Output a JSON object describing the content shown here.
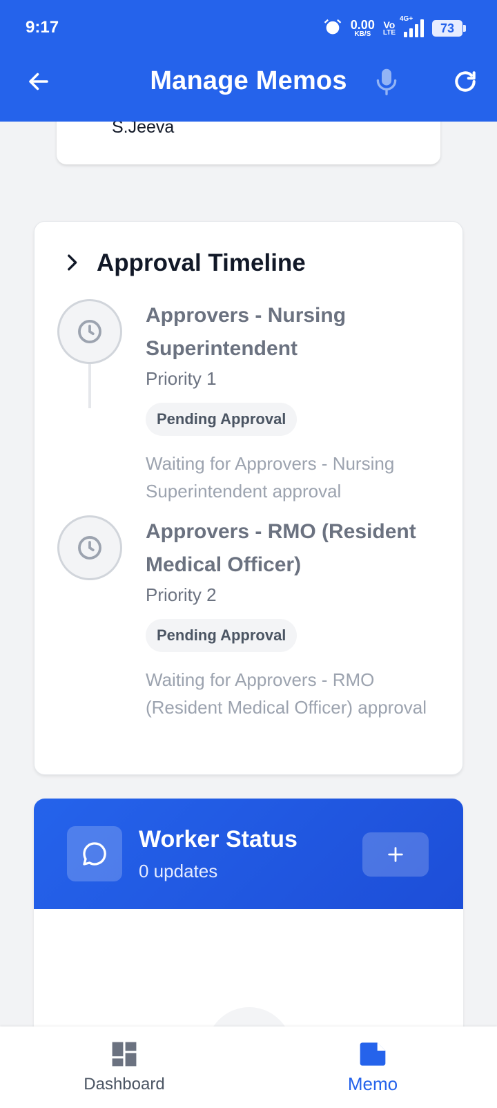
{
  "status_bar": {
    "time": "9:17",
    "net_speed_value": "0.00",
    "net_speed_unit": "KB/S",
    "volte_top": "Vo",
    "volte_bottom": "LTE",
    "network_type": "4G+",
    "battery_level": "73"
  },
  "header": {
    "title": "Manage Memos",
    "back_icon": "arrow-left-icon",
    "mic_icon": "microphone-icon",
    "refresh_icon": "refresh-icon"
  },
  "top_card": {
    "name": "S.Jeeva"
  },
  "approval_timeline": {
    "title": "Approval Timeline",
    "items": [
      {
        "role": "Approvers - Nursing Superintendent",
        "priority": "Priority 1",
        "status": "Pending Approval",
        "note": "Waiting for Approvers - Nursing Superintendent approval"
      },
      {
        "role": "Approvers - RMO (Resident Medical Officer)",
        "priority": "Priority 2",
        "status": "Pending Approval",
        "note": "Waiting for Approvers - RMO (Resident Medical Officer) approval"
      }
    ]
  },
  "worker_status": {
    "title": "Worker Status",
    "updates": "0 updates",
    "add_label": "+"
  },
  "bottom_nav": {
    "items": [
      {
        "label": "Dashboard",
        "icon": "dashboard-icon",
        "active": false
      },
      {
        "label": "Memo",
        "icon": "memo-icon",
        "active": true
      }
    ]
  },
  "colors": {
    "primary": "#2563eb",
    "muted_text": "#6b7280",
    "light_text": "#9ca3af",
    "background": "#f2f3f5"
  }
}
